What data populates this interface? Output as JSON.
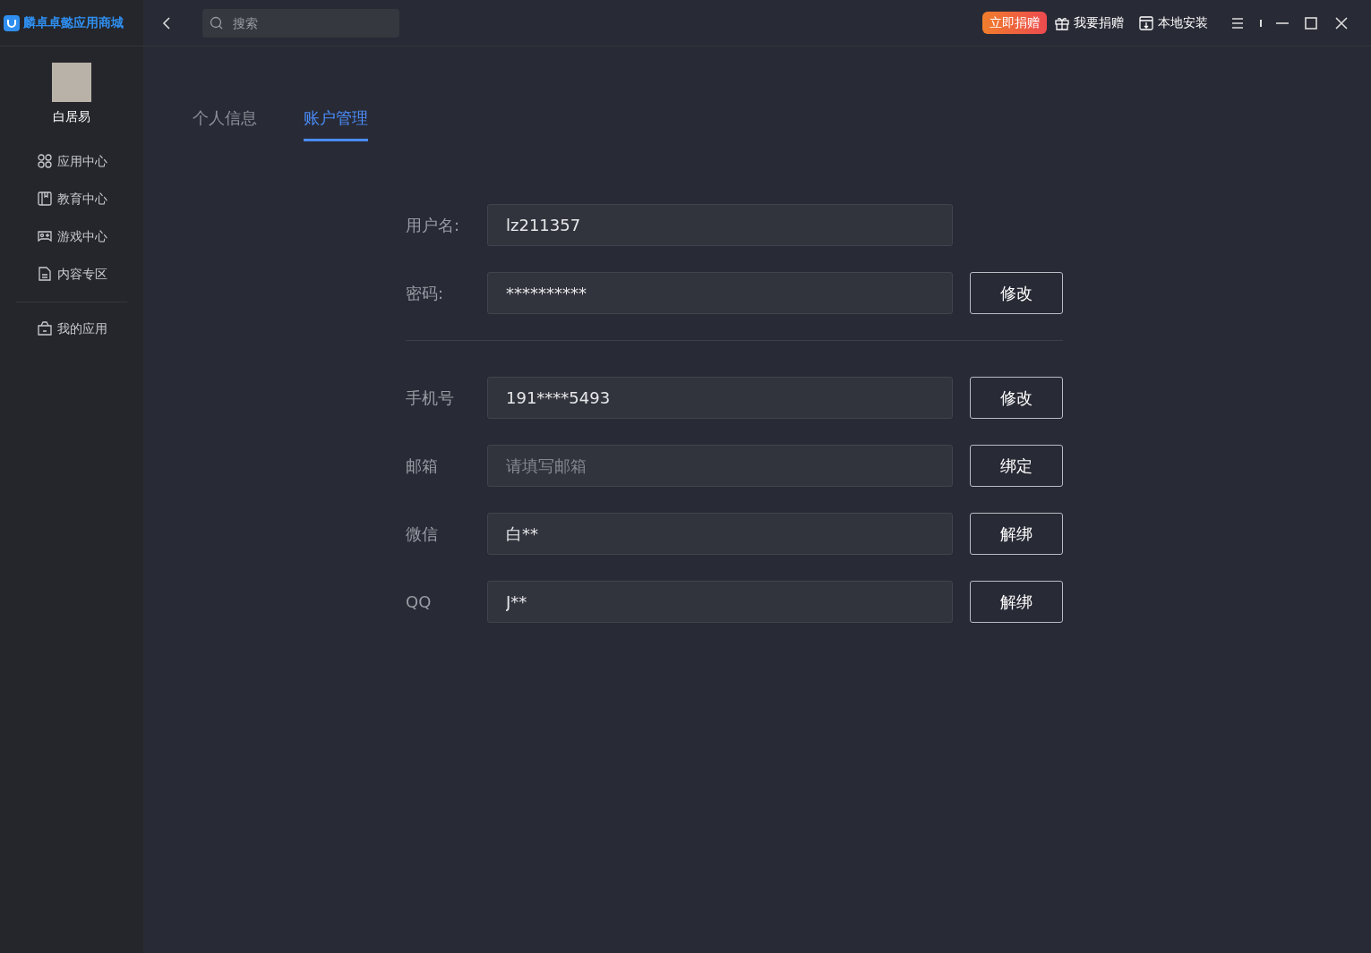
{
  "app": {
    "name": "麟卓卓懿应用商城"
  },
  "search": {
    "placeholder": "搜索"
  },
  "topbar": {
    "donate_badge": "立即捐赠",
    "actions": [
      {
        "kind": "gift",
        "label": "我要捐赠"
      },
      {
        "kind": "install",
        "label": "本地安装"
      }
    ]
  },
  "user": {
    "name": "白居易"
  },
  "sidebar": {
    "items": [
      {
        "kind": "apps",
        "label": "应用中心",
        "selected": false
      },
      {
        "kind": "edu",
        "label": "教育中心",
        "selected": false
      },
      {
        "kind": "game",
        "label": "游戏中心",
        "selected": false
      },
      {
        "kind": "content",
        "label": "内容专区",
        "selected": false
      }
    ],
    "bottom_items": [
      {
        "kind": "bag",
        "label": "我的应用",
        "selected": false
      }
    ]
  },
  "tabs": [
    {
      "label": "个人信息",
      "selected": false
    },
    {
      "label": "账户管理",
      "selected": true
    }
  ],
  "sections": [
    [
      {
        "label": "用户名:",
        "value": "lz211357"
      },
      {
        "label": "密码:",
        "value": "**********",
        "button": "修改"
      }
    ],
    [
      {
        "label": "手机号",
        "value": "191****5493",
        "button": "修改"
      },
      {
        "label": "邮箱",
        "placeholder": "请填写邮箱",
        "button": "绑定"
      },
      {
        "label": "微信",
        "value": "白**",
        "button": "解绑"
      },
      {
        "label": "QQ",
        "value": "J**",
        "button": "解绑"
      }
    ]
  ]
}
